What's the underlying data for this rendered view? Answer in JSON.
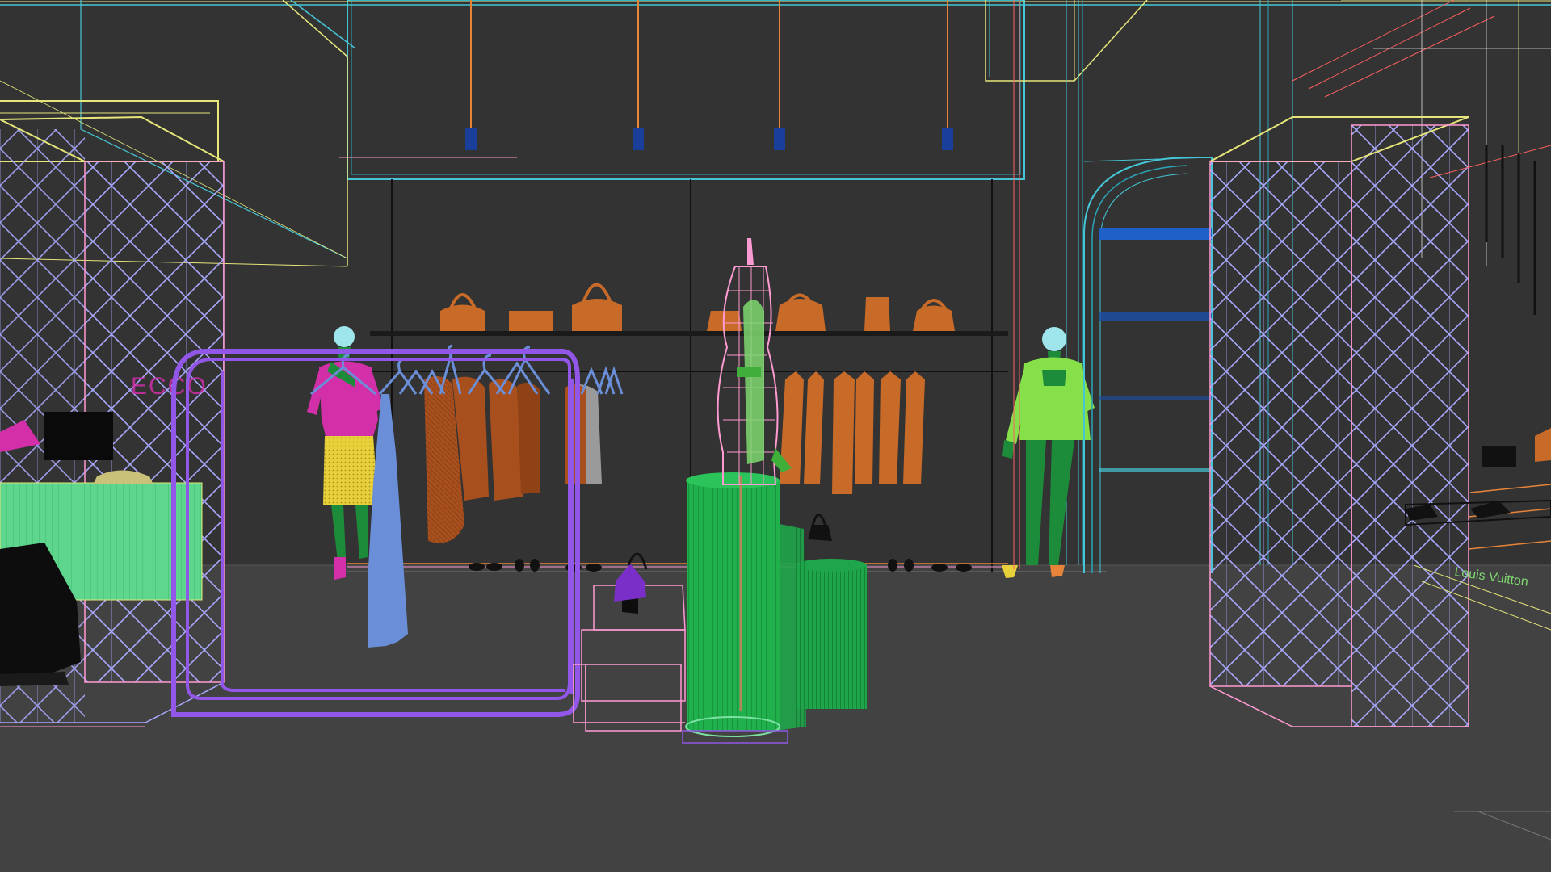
{
  "viewport": {
    "name": "3D wireframe viewport",
    "render_style": "wireframe"
  },
  "scene": {
    "left_sign": "ECCO",
    "right_sign": "Louis Vuitton"
  },
  "colors": {
    "background": "#3a3a3a",
    "floor": "#424242",
    "back_wall": "#333333",
    "purple_rack": "#9257e8",
    "blue_lamps": "#1a3f9a",
    "orange_items": "#c86a28",
    "brown_clothes": "#a84f1e",
    "green_pedestal": "#20b04c",
    "lime_mannequin": "#86e04a",
    "magenta_mannequin": "#d22fa9",
    "pink_wire": "#ff9ad2",
    "lavender_lattice": "#a8a8ff",
    "cyan_wire": "#45c6d6",
    "yellow_wire": "#e6e67a"
  }
}
